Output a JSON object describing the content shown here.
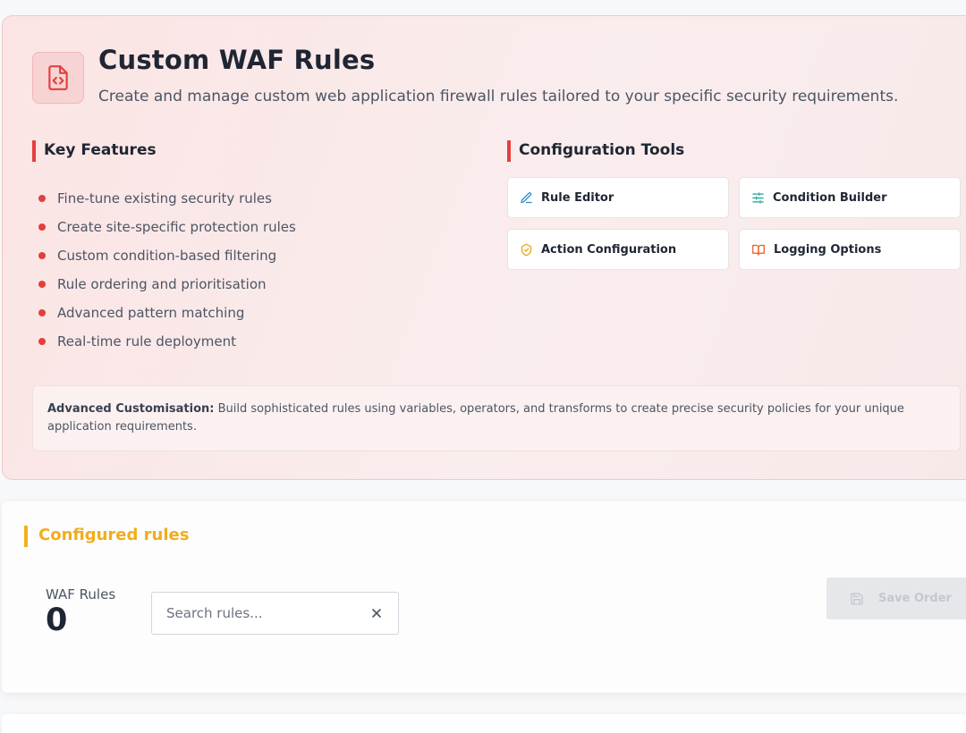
{
  "header": {
    "title": "Custom WAF Rules",
    "subtitle": "Create and manage custom web application firewall rules tailored to your specific security requirements.",
    "icon": "file-code-icon"
  },
  "features": {
    "heading": "Key Features",
    "items": [
      "Fine-tune existing security rules",
      "Create site-specific protection rules",
      "Custom condition-based filtering",
      "Rule ordering and prioritisation",
      "Advanced pattern matching",
      "Real-time rule deployment"
    ]
  },
  "tools": {
    "heading": "Configuration Tools",
    "items": [
      {
        "label": "Rule Editor",
        "icon": "pencil-icon",
        "color": "#2b8ccf"
      },
      {
        "label": "Condition Builder",
        "icon": "sliders-icon",
        "color": "#1aa38f"
      },
      {
        "label": "Action Configuration",
        "icon": "shield-check-icon",
        "color": "#e2a11b"
      },
      {
        "label": "Logging Options",
        "icon": "book-open-icon",
        "color": "#ea5a1e"
      }
    ]
  },
  "note": {
    "label": "Advanced Customisation:",
    "text": "Build sophisticated rules using variables, operators, and transforms to create precise security policies for your unique application requirements."
  },
  "rules": {
    "heading": "Configured rules",
    "count_label": "WAF Rules",
    "count_value": "0",
    "search_placeholder": "Search rules...",
    "save_label": "Save Order"
  },
  "colors": {
    "accent_red": "#e53e3e",
    "accent_amber": "#f2ad1c"
  }
}
